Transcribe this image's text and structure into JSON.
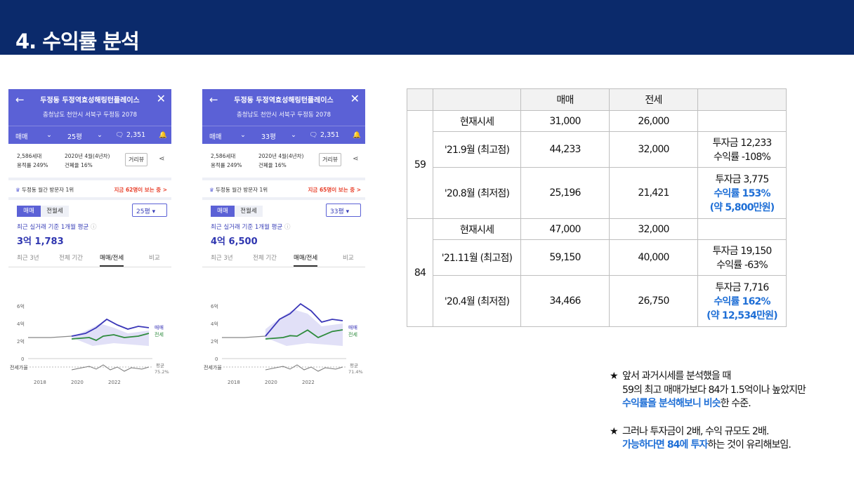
{
  "header": {
    "title": "4. 수익률 분석"
  },
  "phones": [
    {
      "name": "두정동 두정역효성해링턴플레이스",
      "address": "충청남도 천안시 서북구 두정동 2078",
      "trade": "매매",
      "size": "25평",
      "count": "2,351",
      "households": "2,586세대",
      "floor_area": "용적률 249%",
      "built": "2020년 4월(4년차)",
      "coverage": "건폐율 16%",
      "view_button": "거리뷰",
      "visit_label": "두정동 월간 방문자 1위",
      "visit_now": "지금 62명이 보는 중 >",
      "tab_trade": "매매",
      "tab_rent": "전월세",
      "size_select": "25평 ▾",
      "avg_label": "최근 실거래 기준 1개월 평균",
      "avg_value": "3억 1,783",
      "period_tabs": [
        "최근 3년",
        "전체 기간",
        "매매/전세",
        "비교"
      ],
      "y_ticks": [
        "6억",
        "4억",
        "2억",
        "0"
      ],
      "series_labels": [
        "매매",
        "전세"
      ],
      "ratio_label": "전세가율",
      "ratio_avg_label": "평균",
      "ratio_avg_value": "75.2%",
      "x_ticks": [
        "2018",
        "2020",
        "2022"
      ]
    },
    {
      "name": "두정동 두정역효성해링턴플레이스",
      "address": "충청남도 천안시 서북구 두정동 2078",
      "trade": "매매",
      "size": "33평",
      "count": "2,351",
      "households": "2,586세대",
      "floor_area": "용적률 249%",
      "built": "2020년 4월(4년차)",
      "coverage": "건폐율 16%",
      "view_button": "거리뷰",
      "visit_label": "두정동 월간 방문자 1위",
      "visit_now": "지금 65명이 보는 중 >",
      "tab_trade": "매매",
      "tab_rent": "전월세",
      "size_select": "33평 ▾",
      "avg_label": "최근 실거래 기준 1개월 평균",
      "avg_value": "4억 6,500",
      "period_tabs": [
        "최근 3년",
        "전체 기간",
        "매매/전세",
        "비교"
      ],
      "y_ticks": [
        "6억",
        "4억",
        "2억",
        "0"
      ],
      "series_labels": [
        "매매",
        "전세"
      ],
      "ratio_label": "전세가율",
      "ratio_avg_label": "평균",
      "ratio_avg_value": "71.4%",
      "x_ticks": [
        "2018",
        "2020",
        "2022"
      ]
    }
  ],
  "table": {
    "headers": [
      "",
      "",
      "매매",
      "전세",
      ""
    ],
    "groups": [
      {
        "size": "59",
        "rows": [
          {
            "label": "현재시세",
            "sale": "31,000",
            "lease": "26,000",
            "note": []
          },
          {
            "label": "'21.9월 (최고점)",
            "sale": "44,233",
            "lease": "32,000",
            "note": [
              "투자금 12,233",
              "수익률 -108%"
            ]
          },
          {
            "label": "'20.8월 (최저점)",
            "sale": "25,196",
            "lease": "21,421",
            "note": [
              "투자금 3,775"
            ],
            "note_blue": [
              "수익률 153%",
              "(약 5,800만원)"
            ]
          }
        ]
      },
      {
        "size": "84",
        "rows": [
          {
            "label": "현재시세",
            "sale": "47,000",
            "lease": "32,000",
            "note": []
          },
          {
            "label": "'21.11월 (최고점)",
            "sale": "59,150",
            "lease": "40,000",
            "note": [
              "투자금 19,150",
              "수익률 -63%"
            ]
          },
          {
            "label": "'20.4월 (최저점)",
            "sale": "34,466",
            "lease": "26,750",
            "note": [
              "투자금 7,716"
            ],
            "note_blue": [
              "수익률 162%",
              "(약 12,534만원)"
            ]
          }
        ]
      }
    ]
  },
  "notes": {
    "star": "★",
    "n1_line1": "앞서 과거시세를 분석했을 때",
    "n1_line2": "59의 최고 매매가보다 84가 1.5억이나 높았지만",
    "n1_line3_blue": "수익률을 분석해보니 비슷",
    "n1_line3_rest": "한 수준.",
    "n2_line1": "그러나 투자금이 2배, 수익 규모도 2배.",
    "n2_line2_blue": "가능하다면 84에 투자",
    "n2_line2_rest": "하는 것이 유리해보임."
  },
  "colors": {
    "header": "#0b2a6b",
    "app": "#5b61d6",
    "sale_line": "#3a36b8",
    "lease_line": "#2e8b3d",
    "accent_blue": "#1f6fd6"
  }
}
